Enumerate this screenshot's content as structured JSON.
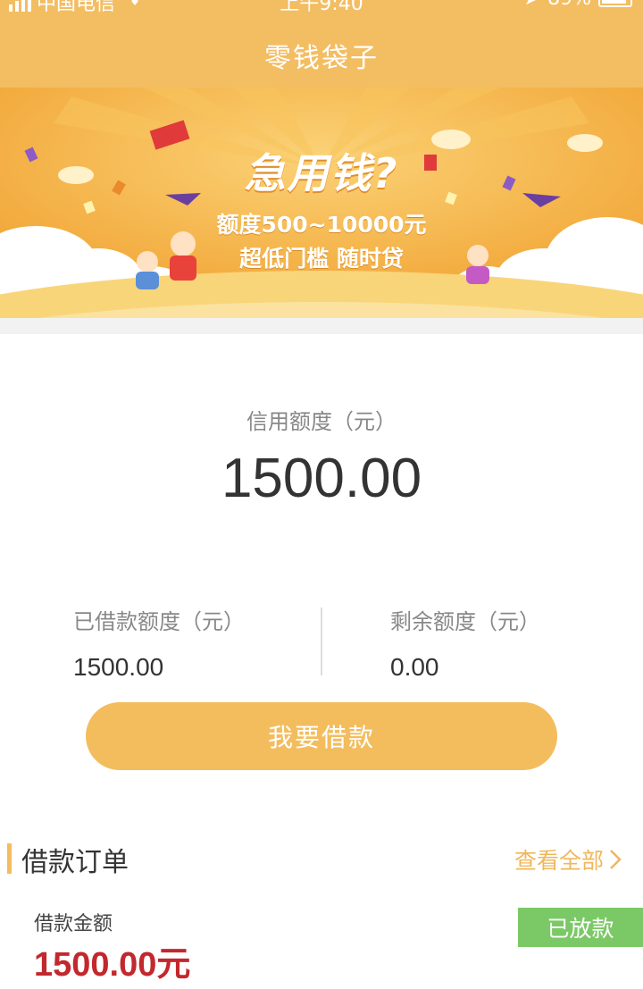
{
  "status_bar": {
    "carrier": "中国电信",
    "time": "上午9:40",
    "battery": "89%"
  },
  "nav": {
    "title": "零钱袋子"
  },
  "banner": {
    "headline": "急用钱?",
    "line1": "额度500~10000元",
    "line2": "超低门槛 随时贷"
  },
  "credit": {
    "label": "信用额度（元）",
    "value": "1500.00",
    "borrowed_label": "已借款额度（元）",
    "borrowed_value": "1500.00",
    "remaining_label": "剩余额度（元）",
    "remaining_value": "0.00"
  },
  "actions": {
    "borrow_label": "我要借款"
  },
  "orders": {
    "title": "借款订单",
    "view_all": "查看全部",
    "item": {
      "amount_label": "借款金额",
      "amount": "1500.00元",
      "status": "已放款"
    }
  },
  "colors": {
    "accent": "#f3bd5e",
    "status_green": "#7bc966",
    "amount_red": "#c2282d"
  }
}
